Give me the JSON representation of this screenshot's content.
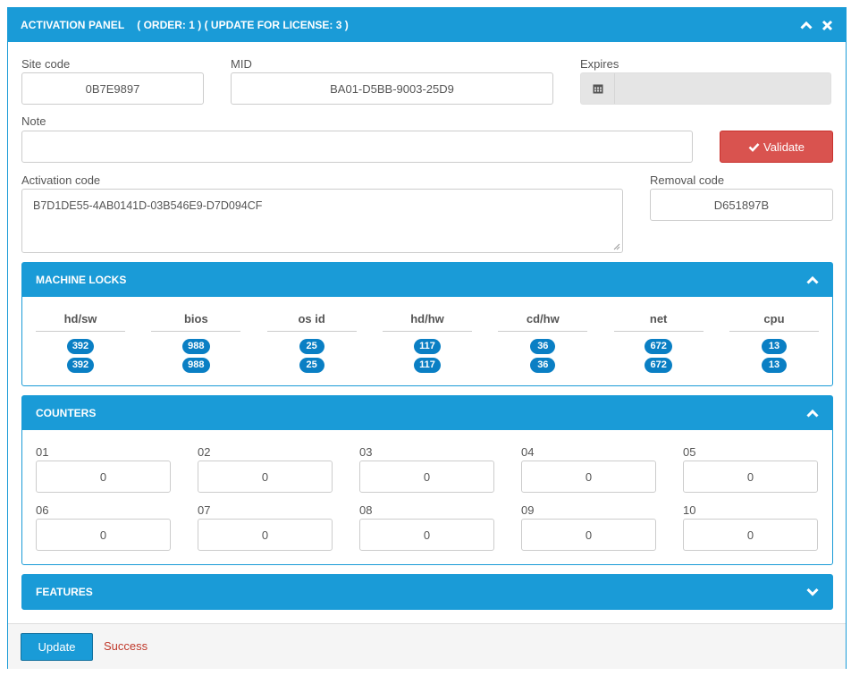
{
  "header": {
    "title": "ACTIVATION PANEL",
    "subtitle": "( ORDER: 1 ) ( UPDATE FOR LICENSE: 3 )"
  },
  "fields": {
    "site_code_label": "Site code",
    "site_code_value": "0B7E9897",
    "mid_label": "MID",
    "mid_value": "BA01-D5BB-9003-25D9",
    "expires_label": "Expires",
    "expires_value": "",
    "note_label": "Note",
    "note_value": "",
    "validate_label": "Validate",
    "activation_label": "Activation code",
    "activation_value": "B7D1DE55-4AB0141D-03B546E9-D7D094CF",
    "removal_label": "Removal code",
    "removal_value": "D651897B"
  },
  "machine_locks": {
    "title": "MACHINE LOCKS",
    "columns": [
      {
        "name": "hd/sw",
        "values": [
          "392",
          "392"
        ]
      },
      {
        "name": "bios",
        "values": [
          "988",
          "988"
        ]
      },
      {
        "name": "os id",
        "values": [
          "25",
          "25"
        ]
      },
      {
        "name": "hd/hw",
        "values": [
          "117",
          "117"
        ]
      },
      {
        "name": "cd/hw",
        "values": [
          "36",
          "36"
        ]
      },
      {
        "name": "net",
        "values": [
          "672",
          "672"
        ]
      },
      {
        "name": "cpu",
        "values": [
          "13",
          "13"
        ]
      }
    ]
  },
  "counters": {
    "title": "COUNTERS",
    "items": [
      {
        "label": "01",
        "value": "0"
      },
      {
        "label": "02",
        "value": "0"
      },
      {
        "label": "03",
        "value": "0"
      },
      {
        "label": "04",
        "value": "0"
      },
      {
        "label": "05",
        "value": "0"
      },
      {
        "label": "06",
        "value": "0"
      },
      {
        "label": "07",
        "value": "0"
      },
      {
        "label": "08",
        "value": "0"
      },
      {
        "label": "09",
        "value": "0"
      },
      {
        "label": "10",
        "value": "0"
      }
    ]
  },
  "features": {
    "title": "FEATURES"
  },
  "footer": {
    "update_label": "Update",
    "status": "Success"
  },
  "colors": {
    "primary": "#1a9bd7",
    "badge": "#0a7fc4",
    "danger": "#d9534f",
    "status": "#c0392b"
  },
  "icons": [
    "chevron-up-icon",
    "close-icon",
    "calendar-icon",
    "check-icon",
    "chevron-down-icon",
    "resize-grip-icon"
  ]
}
